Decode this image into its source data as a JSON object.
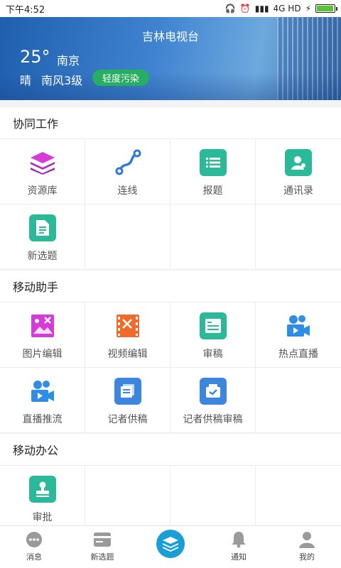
{
  "status_bar": {
    "time": "下午4:52",
    "network": "4G HD"
  },
  "hero": {
    "title": "吉林电视台",
    "temperature": "25°",
    "city": "南京",
    "weather": "晴",
    "wind": "南风3级",
    "air_quality": "轻度污染"
  },
  "sections": [
    {
      "title": "协同工作",
      "items": [
        "资源库",
        "连线",
        "报题",
        "通讯录",
        "新选题"
      ]
    },
    {
      "title": "移动助手",
      "items": [
        "图片编辑",
        "视频编辑",
        "审稿",
        "热点直播",
        "直播推流",
        "记者供稿",
        "记者供稿审稿"
      ]
    },
    {
      "title": "移动办公",
      "items": [
        "审批"
      ]
    }
  ],
  "tabbar": {
    "items": [
      "消息",
      "新选题",
      "",
      "通知",
      "我的"
    ]
  },
  "colors": {
    "teal": "#2ab999",
    "blue": "#3d86df",
    "accent": "#1a9ed8",
    "badge": "#27ae60"
  }
}
